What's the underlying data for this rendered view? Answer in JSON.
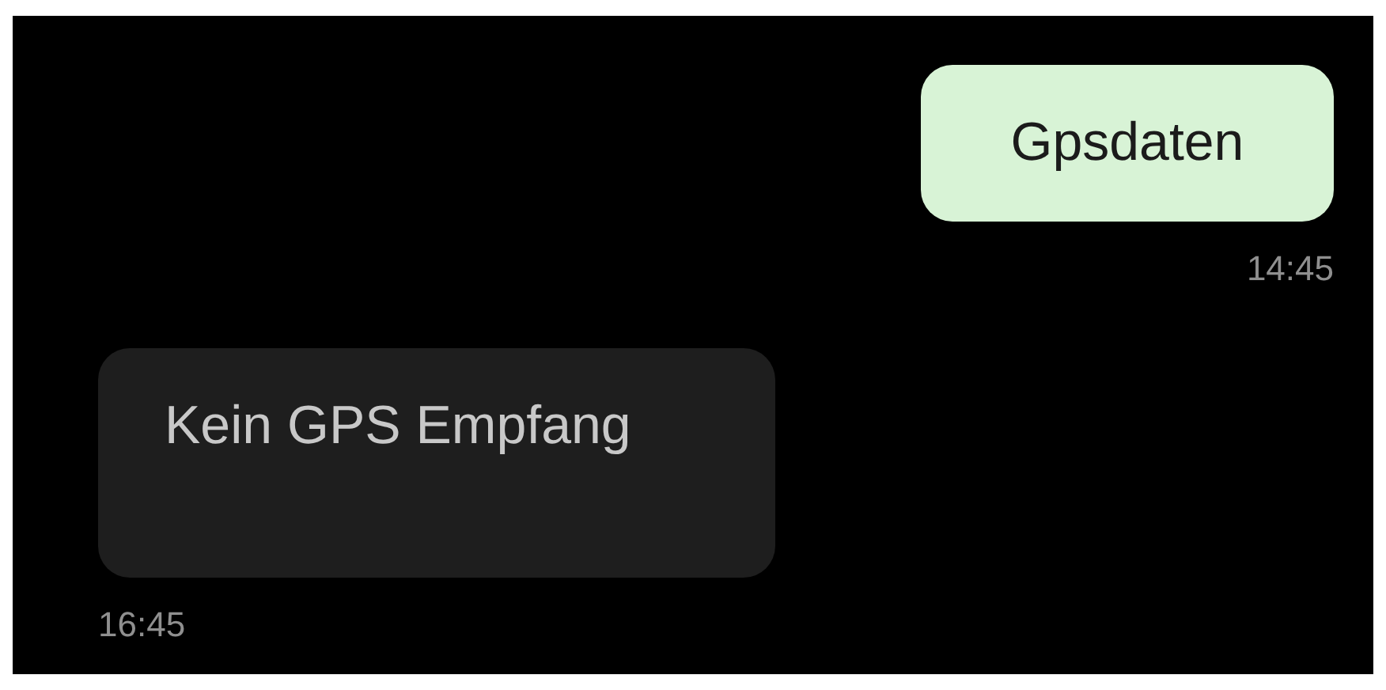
{
  "messages": [
    {
      "kind": "sent",
      "text": "Gpsdaten",
      "time": "14:45"
    },
    {
      "kind": "received",
      "text": "Kein GPS Empfang",
      "time": "16:45"
    }
  ]
}
